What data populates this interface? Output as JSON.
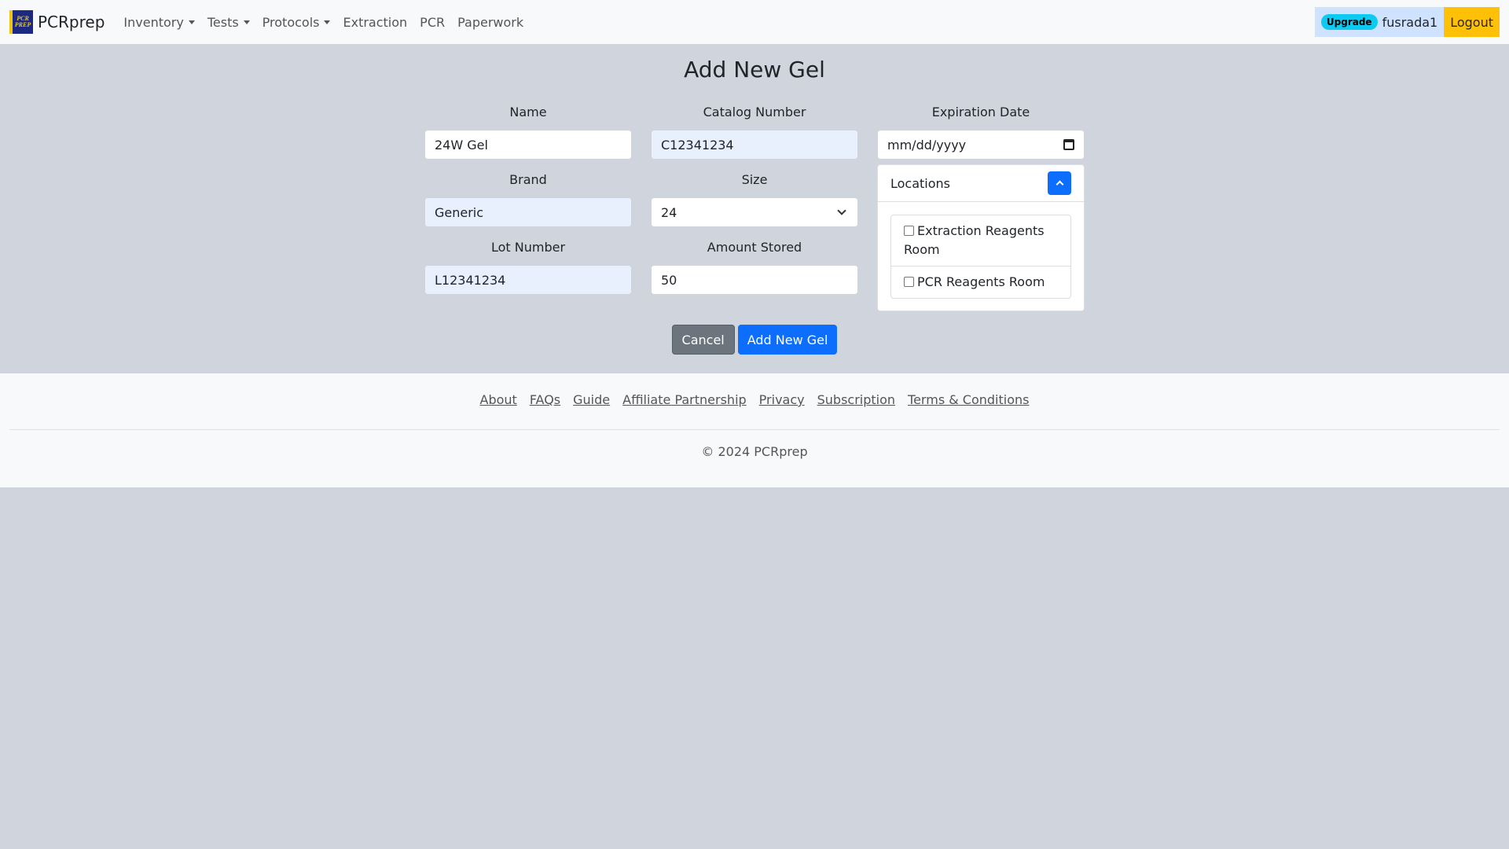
{
  "navbar": {
    "logo_text": "PCR PREP",
    "brand": "PCRprep",
    "items": [
      {
        "label": "Inventory",
        "dropdown": true
      },
      {
        "label": "Tests",
        "dropdown": true
      },
      {
        "label": "Protocols",
        "dropdown": true
      },
      {
        "label": "Extraction",
        "dropdown": false
      },
      {
        "label": "PCR",
        "dropdown": false
      },
      {
        "label": "Paperwork",
        "dropdown": false
      }
    ],
    "upgrade": "Upgrade",
    "username": "fusrada1",
    "logout": "Logout"
  },
  "form": {
    "title": "Add New Gel",
    "name": {
      "label": "Name",
      "value": "24W Gel"
    },
    "catalog": {
      "label": "Catalog Number",
      "value": "C12341234"
    },
    "expiration": {
      "label": "Expiration Date",
      "value": "mm/dd/yyyy"
    },
    "brand": {
      "label": "Brand",
      "value": "Generic"
    },
    "size": {
      "label": "Size",
      "value": "24"
    },
    "lot": {
      "label": "Lot Number",
      "value": "L12341234"
    },
    "amount": {
      "label": "Amount Stored",
      "value": "50"
    },
    "locations": {
      "title": "Locations",
      "items": [
        "Extraction Reagents Room",
        "PCR Reagents Room"
      ]
    },
    "cancel": "Cancel",
    "submit": "Add New Gel"
  },
  "footer": {
    "links": [
      "About",
      "FAQs",
      "Guide",
      "Affiliate Partnership",
      "Privacy",
      "Subscription",
      "Terms & Conditions"
    ],
    "copyright": "© 2024 PCRprep"
  },
  "colors": {
    "page_bg": "#d0d4dc",
    "primary": "#0d6efd",
    "secondary": "#6c757d",
    "warning": "#ffc107",
    "info": "#0dcaf0"
  }
}
